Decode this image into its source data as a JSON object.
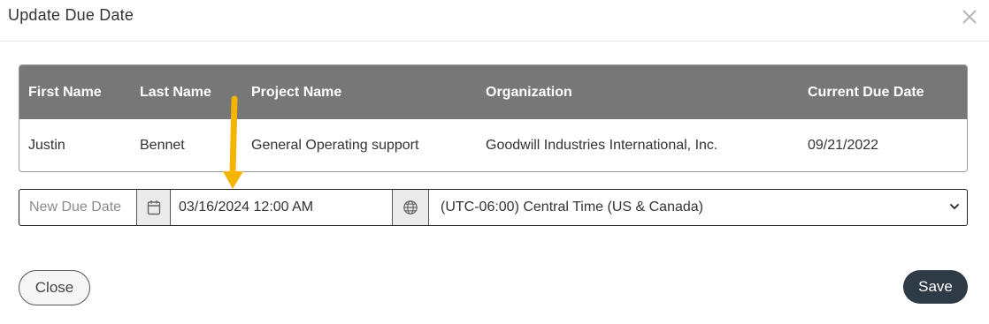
{
  "dialog": {
    "title": "Update Due Date"
  },
  "table": {
    "headers": [
      "First Name",
      "Last Name",
      "Project Name",
      "Organization",
      "Current Due Date"
    ],
    "rows": [
      [
        "Justin",
        "Bennet",
        "General Operating support",
        "Goodwill Industries International, Inc.",
        "09/21/2022"
      ]
    ]
  },
  "due_date": {
    "label": "New Due Date",
    "value": "03/16/2024 12:00 AM",
    "calendar_icon": "calendar-icon",
    "globe_icon": "globe-icon",
    "timezone": "(UTC-06:00) Central Time (US & Canada)"
  },
  "annotation": {
    "arrow_color": "#f4b400"
  },
  "footer": {
    "close_label": "Close",
    "save_label": "Save",
    "save_color": "#2f3a47"
  }
}
